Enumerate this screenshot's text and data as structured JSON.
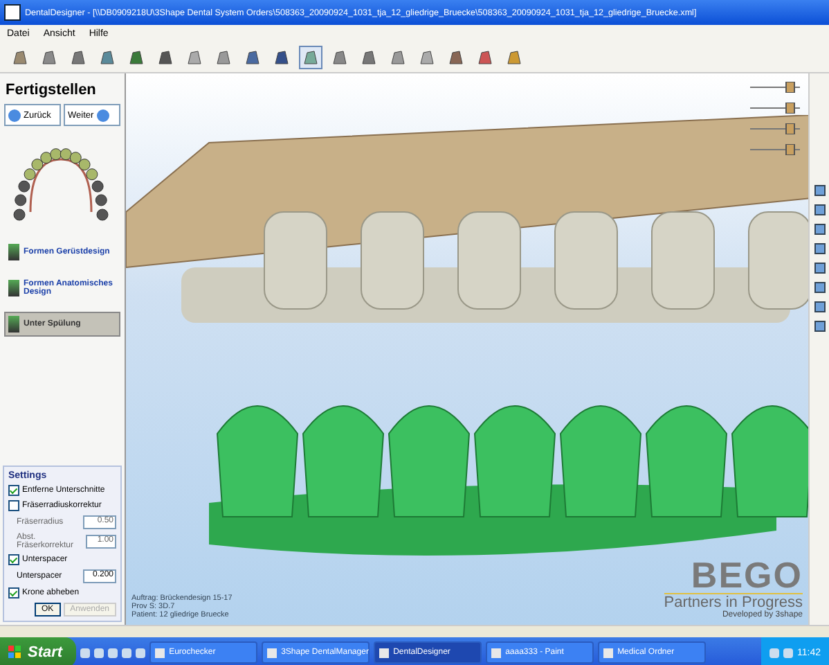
{
  "window": {
    "title": "DentalDesigner - [\\\\DB0909218U\\3Shape Dental System Orders\\508363_20090924_1031_tja_12_gliedrige_Bruecke\\508363_20090924_1031_tja_12_gliedrige_Bruecke.xml]"
  },
  "menu": [
    "Datei",
    "Ansicht",
    "Hilfe"
  ],
  "toolbar": [
    {
      "selected": false
    },
    {
      "selected": false
    },
    {
      "selected": false
    },
    {
      "selected": false
    },
    {
      "selected": false
    },
    {
      "selected": false
    },
    {
      "selected": false
    },
    {
      "selected": false
    },
    {
      "selected": false
    },
    {
      "selected": false
    },
    {
      "selected": true
    },
    {
      "selected": false
    },
    {
      "selected": false
    },
    {
      "selected": false
    },
    {
      "selected": false
    },
    {
      "selected": false
    },
    {
      "selected": false
    },
    {
      "selected": false
    }
  ],
  "panel": {
    "title": "Fertigstellen",
    "back": "Zurück",
    "next": "Weiter",
    "steps": [
      {
        "label": "Formen Gerüstdesign",
        "selected": false
      },
      {
        "label": "Formen Anatomisches Design",
        "selected": false
      },
      {
        "label": "Unter Spülung",
        "selected": true
      }
    ]
  },
  "settings": {
    "title": "Settings",
    "items": [
      {
        "kind": "check",
        "label": "Entferne Unterschnitte",
        "checked": true
      },
      {
        "kind": "check",
        "label": "Fräserradiuskorrektur",
        "checked": false
      },
      {
        "kind": "number",
        "label": "Fräserradius",
        "value": "0.50",
        "disabled": true
      },
      {
        "kind": "number",
        "label": "Abst. Fräserkorrektur",
        "value": "1.00",
        "disabled": true
      },
      {
        "kind": "check",
        "label": "Unterspacer",
        "checked": true
      },
      {
        "kind": "number",
        "label": "Unterspacer",
        "value": "0.200",
        "disabled": false
      },
      {
        "kind": "check",
        "label": "Krone abheben",
        "checked": true
      }
    ],
    "ok": "OK",
    "apply": "Anwenden"
  },
  "info": [
    "Auftrag: Brückendesign 15-17",
    "Prov S: 3D.7",
    "Patient: 12 gliedrige Bruecke"
  ],
  "logo": {
    "name": "BEGO",
    "tagline": "Partners in Progress",
    "developed": "Developed by 3shape"
  },
  "taskbar": {
    "start": "Start",
    "items": [
      {
        "label": "Eurochecker",
        "selected": false
      },
      {
        "label": "3Shape DentalManager",
        "selected": false
      },
      {
        "label": "DentalDesigner",
        "selected": true
      },
      {
        "label": "aaaa333 - Paint",
        "selected": false
      },
      {
        "label": "Medical Ordner",
        "selected": false
      }
    ],
    "clock": "11:42"
  }
}
